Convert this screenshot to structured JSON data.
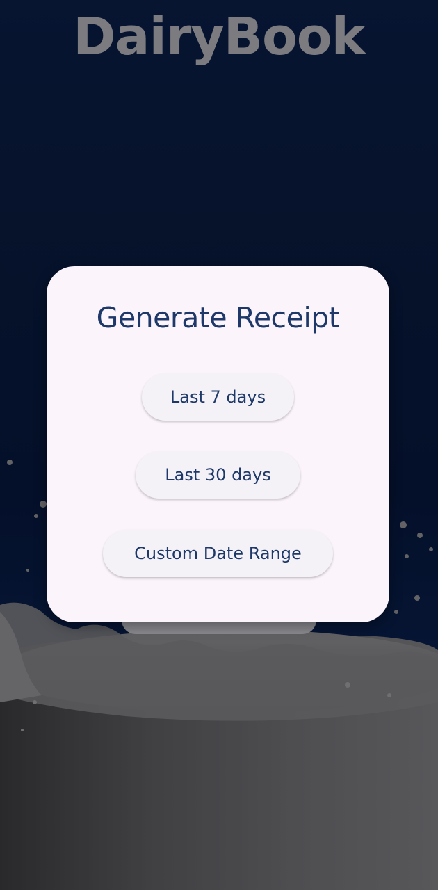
{
  "app": {
    "title": "DairyBook"
  },
  "dialog": {
    "title": "Generate Receipt",
    "options": [
      {
        "label": "Last 7 days"
      },
      {
        "label": "Last 30 days"
      },
      {
        "label": "Custom Date Range"
      }
    ]
  },
  "colors": {
    "background": "#0a1f47",
    "dialog_bg": "#fbf4fb",
    "text_primary": "#1d3869",
    "button_bg": "#f4f2f7",
    "app_title": "#7c7c80"
  },
  "icons": {
    "background_art": "milk-splash-glass"
  }
}
